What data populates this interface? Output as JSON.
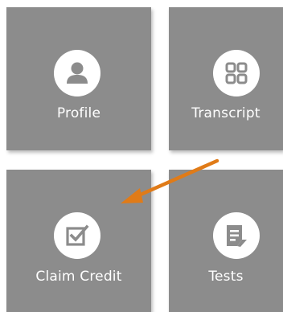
{
  "tiles": [
    {
      "label": "Profile",
      "icon": "person-icon"
    },
    {
      "label": "Transcript",
      "icon": "grid-icon"
    },
    {
      "label": "Claim Credit",
      "icon": "checkbox-icon"
    },
    {
      "label": "Tests",
      "icon": "document-icon"
    }
  ],
  "colors": {
    "tile": "#8c8c8c",
    "icon": "#8c8c8c",
    "arrow": "#e07b18"
  }
}
